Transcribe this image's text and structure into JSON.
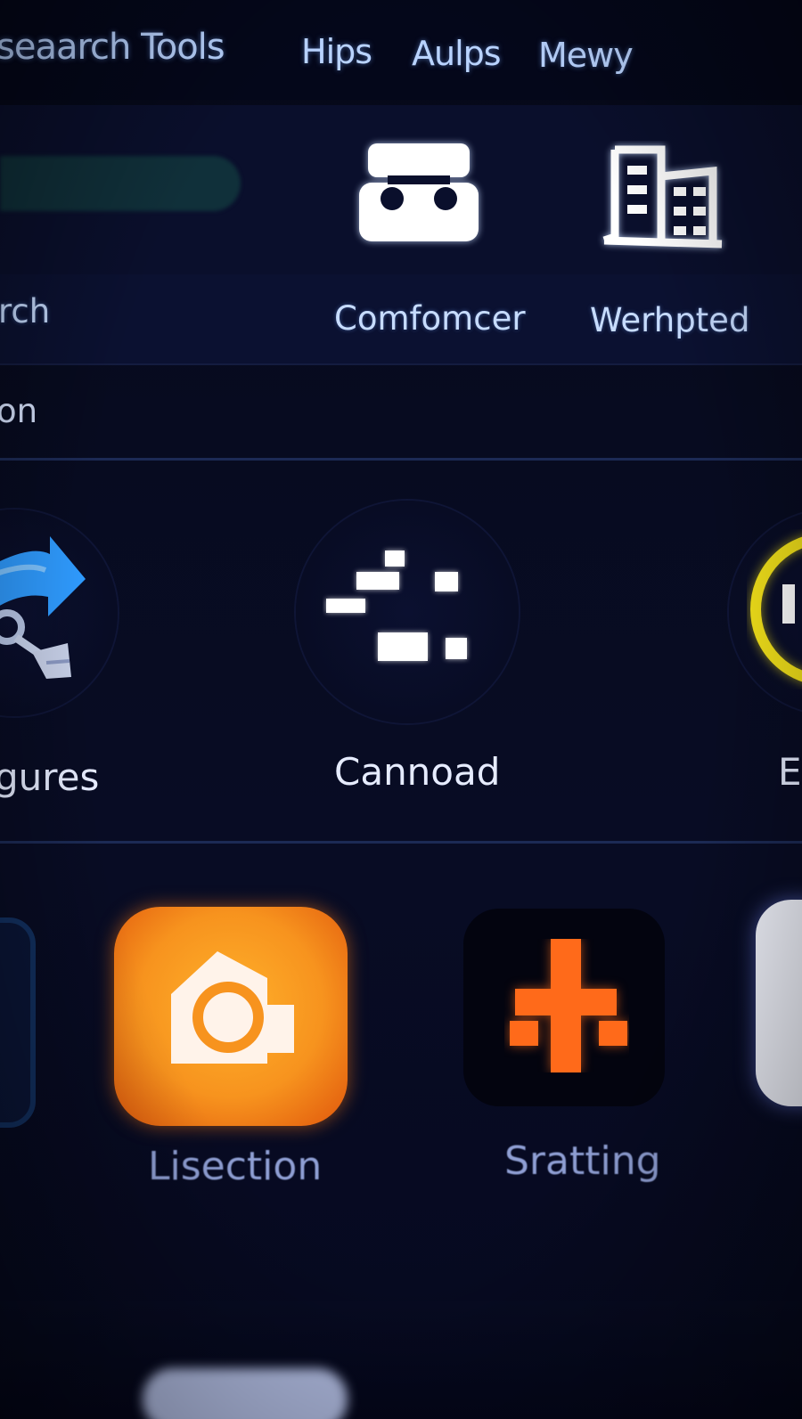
{
  "menubar": {
    "items": [
      "seaarch Tools",
      "Hips",
      "Aulps",
      "Mewy"
    ]
  },
  "toolbar": {
    "search_label": "rch",
    "tools": [
      {
        "label": "Comfomcer",
        "icon": "robot-face-icon"
      },
      {
        "label": "Werhpted",
        "icon": "building-icon"
      }
    ]
  },
  "section": {
    "label": "on"
  },
  "middle_row": [
    {
      "label": "gures",
      "icon": "share-arrow-icon"
    },
    {
      "label": "Cannoad",
      "icon": "scattered-blocks-icon"
    },
    {
      "label": "E",
      "icon": "yellow-ring-icon"
    }
  ],
  "bottom_row": [
    {
      "label": "Lisection",
      "icon": "camera-house-icon",
      "color": "#f7931e"
    },
    {
      "label": "Sratting",
      "icon": "orange-cross-icon",
      "color": "#ff6a1a"
    }
  ],
  "colors": {
    "background": "#05081c",
    "accent_blue": "#2f9bff",
    "accent_orange": "#f7931e",
    "accent_yellow": "#f2e11a"
  }
}
